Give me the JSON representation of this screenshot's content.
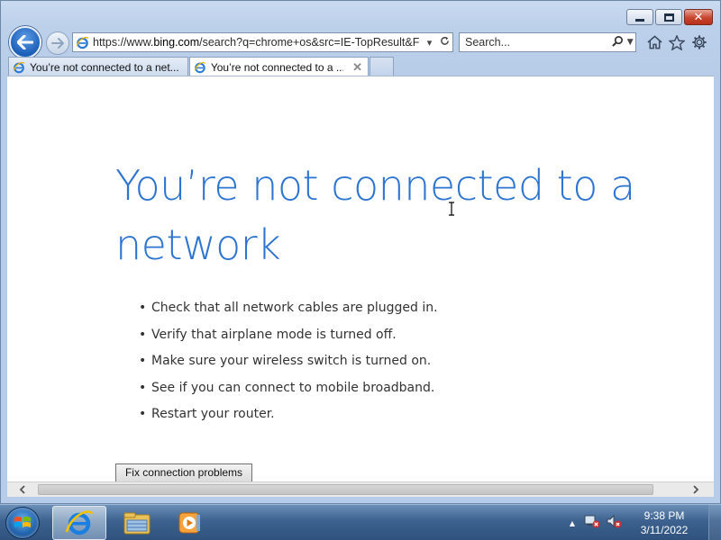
{
  "window": {
    "controls": {
      "minimize": "minimize",
      "maximize": "maximize",
      "close": "close"
    }
  },
  "navigation": {
    "back_icon": "back-arrow-icon",
    "forward_icon": "forward-arrow-icon",
    "address": {
      "prefix": "https://www.",
      "domain": "bing.com",
      "path": "/search?q=chrome+os&src=IE-TopResult&F",
      "favicon": "ie-icon"
    },
    "search": {
      "placeholder": "Search..."
    },
    "toolbar_icons": [
      "home-icon",
      "favorites-star-icon",
      "settings-gear-icon"
    ]
  },
  "tabs": [
    {
      "label": "You’re not connected to a net...",
      "active": false
    },
    {
      "label": "You’re not connected to a ...",
      "active": true
    }
  ],
  "page": {
    "title": "You’re not connected to a network",
    "tips": [
      "Check that all network cables are plugged in.",
      "Verify that airplane mode is turned off.",
      "Make sure your wireless switch is turned on.",
      "See if you can connect to mobile broadband.",
      "Restart your router."
    ],
    "fix_button": "Fix connection problems"
  },
  "taskbar": {
    "start": "start-orb",
    "pinned": [
      "internet-explorer-icon",
      "file-explorer-icon",
      "media-player-icon"
    ],
    "clock": {
      "time": "9:38 PM",
      "date": "3/11/2022"
    }
  },
  "colors": {
    "title_blue": "#2e74d1",
    "taskbar": "#3d628f"
  }
}
